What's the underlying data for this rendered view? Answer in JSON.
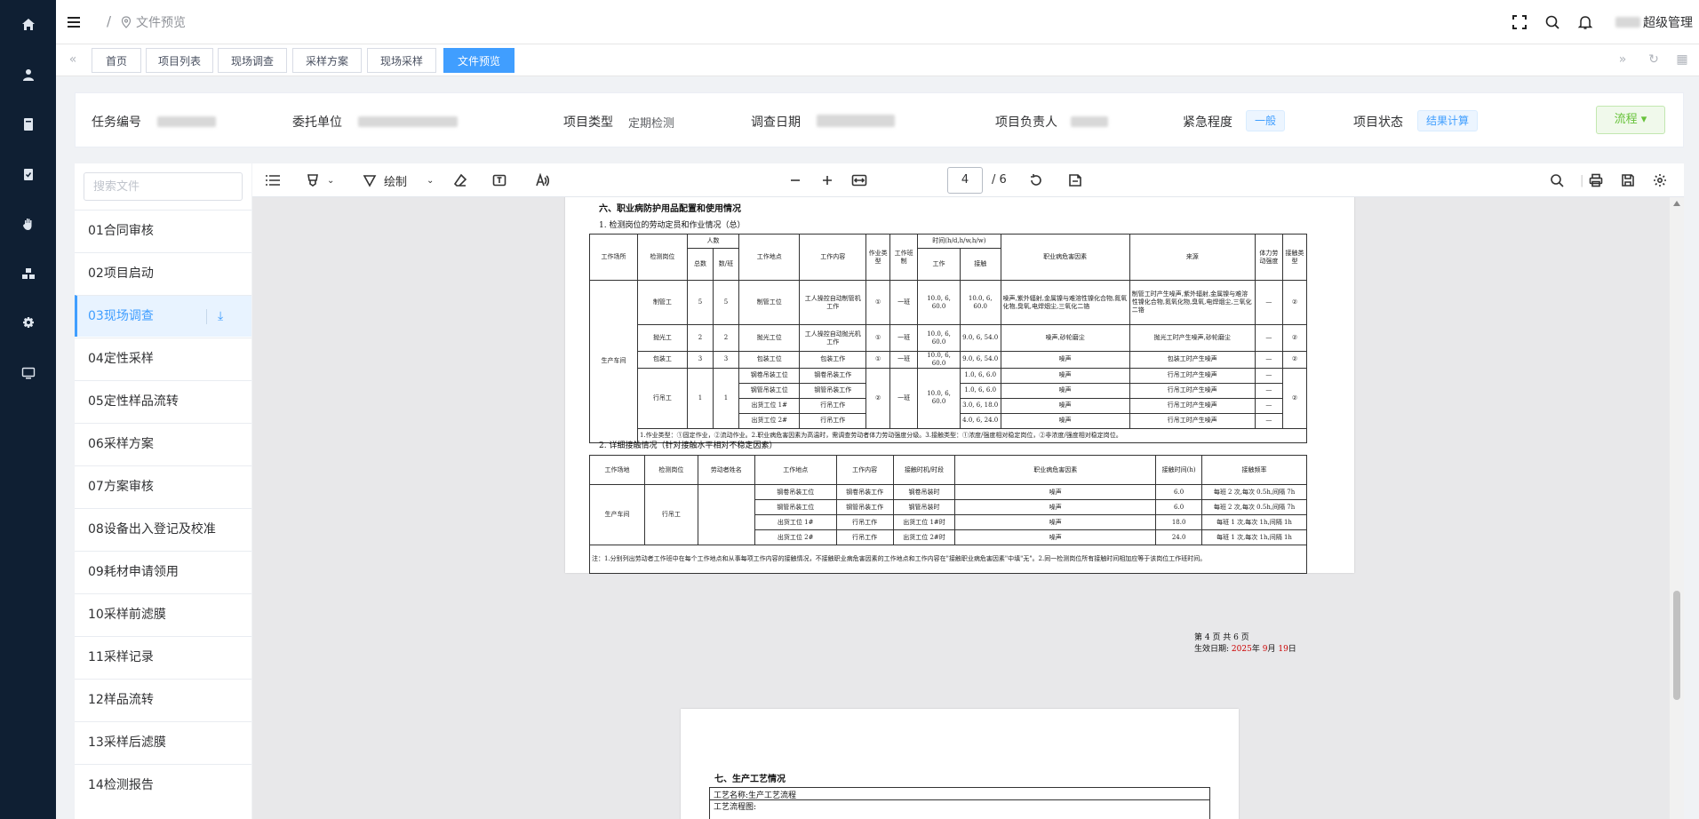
{
  "header": {
    "breadcrumb_sep": "/",
    "breadcrumb": "文件预览",
    "user": "超级管理"
  },
  "tabs": [
    "首页",
    "项目列表",
    "现场调查",
    "采样方案",
    "现场采样",
    "文件预览"
  ],
  "info": {
    "task_no_label": "任务编号",
    "client_label": "委托单位",
    "type_label": "项目类型",
    "type_value": "定期检测",
    "date_label": "调查日期",
    "leader_label": "项目负责人",
    "urgency_label": "紧急程度",
    "urgency_value": "一般",
    "status_label": "项目状态",
    "status_value": "结果计算",
    "flow_button": "流程 ▾"
  },
  "files": {
    "search_placeholder": "搜索文件",
    "items": [
      "01合同审核",
      "02项目启动",
      "03现场调查",
      "04定性采样",
      "05定性样品流转",
      "06采样方案",
      "07方案审核",
      "08设备出入登记及校准",
      "09耗材申请领用",
      "10采样前滤膜",
      "11采样记录",
      "12样品流转",
      "13采样后滤膜",
      "14检测报告"
    ],
    "active_index": 2
  },
  "pdf_toolbar": {
    "draw_label": "绘制",
    "page_current": "4",
    "page_total": "/ 6"
  },
  "doc": {
    "section6": "六、职业病防护用品配置和使用情况",
    "sub1": "1. 检测岗位的劳动定员和作业情况（总）",
    "t1_headers": {
      "workplace": "工作场所",
      "post": "检测岗位",
      "people": "人数",
      "total": "总数",
      "per_shift": "数/班",
      "location": "工作地点",
      "content": "工作内容",
      "op_type": "作业类型",
      "shift": "工作班制",
      "time": "时间(h/d,h/w,h/w)",
      "work": "工作",
      "contact": "接触",
      "hazards": "职业病危害因素",
      "source": "来源",
      "intensity": "体力劳动强度",
      "contact_type": "接触类型"
    },
    "t1_workplace": "生产车间",
    "t1_rows": [
      {
        "post": "制管工",
        "total": "5",
        "per": "5",
        "loc": "制管工位",
        "content": "工人操控自动制管机工作",
        "op": "①",
        "shift": "一班",
        "work": "10.0, 6, 60.0",
        "contact": "10.0, 6, 60.0",
        "hazard": "噪声,紫外辐射,金属镍与难溶性镍化合物,氮氧化物,臭氧,电焊烟尘,三氧化二铬",
        "source": "制管工时产生噪声,紫外辐射,金属镍与难溶性镍化合物,氮氧化物,臭氧,电焊烟尘,三氧化二铬",
        "int": "—",
        "ct": "②"
      },
      {
        "post": "抛光工",
        "total": "2",
        "per": "2",
        "loc": "抛光工位",
        "content": "工人操控自动抛光机工作",
        "op": "①",
        "shift": "一班",
        "work": "10.0, 6, 60.0",
        "contact": "9.0, 6, 54.0",
        "hazard": "噪声,砂轮磨尘",
        "source": "抛光工时产生噪声,砂轮磨尘",
        "int": "—",
        "ct": "②"
      },
      {
        "post": "包装工",
        "total": "3",
        "per": "3",
        "loc": "包装工位",
        "content": "包装工作",
        "op": "①",
        "shift": "一班",
        "work": "10.0, 6, 60.0",
        "contact": "9.0, 6, 54.0",
        "hazard": "噪声",
        "source": "包装工时产生噪声",
        "int": "—",
        "ct": "②"
      }
    ],
    "t1_crane": {
      "post": "行吊工",
      "total": "1",
      "per": "1",
      "op": "②",
      "shift": "一班",
      "work": "10.0, 6, 60.0",
      "ct": "②",
      "rows": [
        {
          "loc": "钢卷吊装工位",
          "content": "钢卷吊装工作",
          "contact": "1.0, 6, 6.0",
          "hazard": "噪声",
          "source": "行吊工时产生噪声",
          "int": "—"
        },
        {
          "loc": "钢管吊装工位",
          "content": "钢管吊装工作",
          "contact": "1.0, 6, 6.0",
          "hazard": "噪声",
          "source": "行吊工时产生噪声",
          "int": "—"
        },
        {
          "loc": "出货工位 1#",
          "content": "行吊工作",
          "contact": "3.0, 6, 18.0",
          "hazard": "噪声",
          "source": "行吊工时产生噪声",
          "int": "—"
        },
        {
          "loc": "出货工位 2#",
          "content": "行吊工作",
          "contact": "4.0, 6, 24.0",
          "hazard": "噪声",
          "source": "行吊工时产生噪声",
          "int": "—"
        }
      ]
    },
    "t1_note": "1.作业类型：①固定作业，②流动作业。2.职业病危害因素为高温时，需调查劳动者体力劳动强度分级。3.接触类型：①浓度/强度相对稳定岗位，②非浓度/强度相对稳定岗位。",
    "sub2": "2. 详细接触情况（针对接触水平相对不稳定因素）",
    "t2_headers": {
      "site": "工作场地",
      "post": "检测岗位",
      "worker": "劳动者姓名",
      "loc": "工作地点",
      "content": "工作内容",
      "period": "接触时机/时段",
      "hazard": "职业病危害因素",
      "time": "接触时间(h)",
      "freq": "接触频率"
    },
    "t2_site": "生产车间",
    "t2_post": "行吊工",
    "t2_rows": [
      {
        "loc": "钢卷吊装工位",
        "content": "钢卷吊装工作",
        "period": "钢卷吊装时",
        "hazard": "噪声",
        "time": "6.0",
        "freq": "每班 2 次,每次 0.5h,间隔 7h"
      },
      {
        "loc": "钢管吊装工位",
        "content": "钢管吊装工作",
        "period": "钢管吊装时",
        "hazard": "噪声",
        "time": "6.0",
        "freq": "每班 2 次,每次 0.5h,间隔 7h"
      },
      {
        "loc": "出货工位 1#",
        "content": "行吊工作",
        "period": "出货工位 1#时",
        "hazard": "噪声",
        "time": "18.0",
        "freq": "每班 1 次,每次 1h,间隔 1h"
      },
      {
        "loc": "出货工位 2#",
        "content": "行吊工作",
        "period": "出货工位 2#时",
        "hazard": "噪声",
        "time": "24.0",
        "freq": "每班 1 次,每次 1h,间隔 1h"
      }
    ],
    "t2_note": "注：1.分别列出劳动者工作班中在每个工作地点和从事每项工作内容的接触情况，不接触职业病危害因素的工作地点和工作内容在\"接触职业病危害因素\"中填\"无\"。2.同一检测岗位所有接触时间相加应等于该岗位工作班时间。",
    "footer_page": "第 4 页 共 6 页",
    "footer_date_label": "生效日期:",
    "footer_year": "2025",
    "footer_y": "年",
    "footer_month": "9",
    "footer_m": "月",
    "footer_day": "19",
    "footer_d": "日",
    "section7": "七、生产工艺情况",
    "proc_name": "工艺名称:生产工艺流程",
    "proc_chart": "工艺流程图:"
  }
}
